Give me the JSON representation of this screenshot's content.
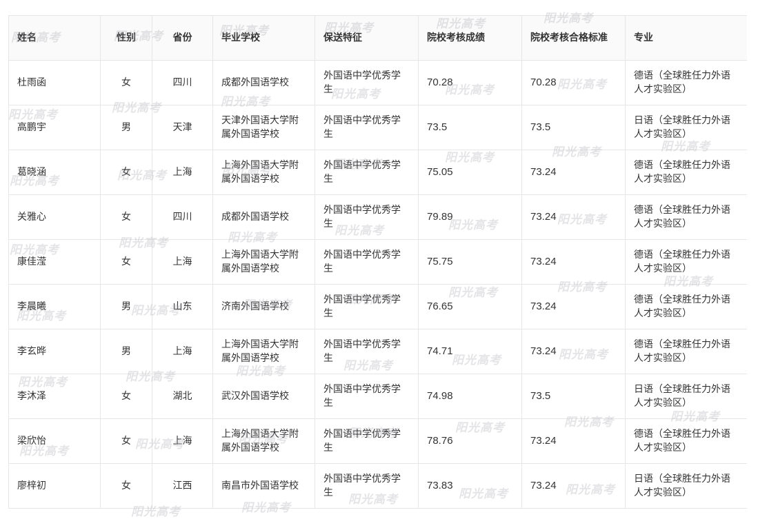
{
  "table": {
    "headers": {
      "name": "姓名",
      "gender": "性别",
      "province": "省份",
      "school": "毕业学校",
      "feature": "保送特征",
      "score": "院校考核成绩",
      "pass_line": "院校考核合格标准",
      "major": "专业"
    },
    "rows": [
      {
        "name": "杜雨函",
        "gender": "女",
        "province": "四川",
        "school": "成都外国语学校",
        "feature": "外国语中学优秀学生",
        "score": "70.28",
        "pass_line": "70.28",
        "major": "德语（全球胜任力外语人才实验区）"
      },
      {
        "name": "高鹏宇",
        "gender": "男",
        "province": "天津",
        "school": "天津外国语大学附属外国语学校",
        "feature": "外国语中学优秀学生",
        "score": "73.5",
        "pass_line": "73.5",
        "major": "日语（全球胜任力外语人才实验区）"
      },
      {
        "name": "葛晓涵",
        "gender": "女",
        "province": "上海",
        "school": "上海外国语大学附属外国语学校",
        "feature": "外国语中学优秀学生",
        "score": "75.05",
        "pass_line": "73.24",
        "major": "德语（全球胜任力外语人才实验区）"
      },
      {
        "name": "关雅心",
        "gender": "女",
        "province": "四川",
        "school": "成都外国语学校",
        "feature": "外国语中学优秀学生",
        "score": "79.89",
        "pass_line": "73.24",
        "major": "德语（全球胜任力外语人才实验区）"
      },
      {
        "name": "康佳滢",
        "gender": "女",
        "province": "上海",
        "school": "上海外国语大学附属外国语学校",
        "feature": "外国语中学优秀学生",
        "score": "75.75",
        "pass_line": "73.24",
        "major": "德语（全球胜任力外语人才实验区）"
      },
      {
        "name": "李晨曦",
        "gender": "男",
        "province": "山东",
        "school": "济南外国语学校",
        "feature": "外国语中学优秀学生",
        "score": "76.65",
        "pass_line": "73.24",
        "major": "德语（全球胜任力外语人才实验区）"
      },
      {
        "name": "李玄晔",
        "gender": "男",
        "province": "上海",
        "school": "上海外国语大学附属外国语学校",
        "feature": "外国语中学优秀学生",
        "score": "74.71",
        "pass_line": "73.24",
        "major": "德语（全球胜任力外语人才实验区）"
      },
      {
        "name": "李沐泽",
        "gender": "女",
        "province": "湖北",
        "school": "武汉外国语学校",
        "feature": "外国语中学优秀学生",
        "score": "74.98",
        "pass_line": "73.5",
        "major": "日语（全球胜任力外语人才实验区）"
      },
      {
        "name": "梁欣怡",
        "gender": "女",
        "province": "上海",
        "school": "上海外国语大学附属外国语学校",
        "feature": "外国语中学优秀学生",
        "score": "78.76",
        "pass_line": "73.24",
        "major": "德语（全球胜任力外语人才实验区）"
      },
      {
        "name": "廖梓初",
        "gender": "女",
        "province": "江西",
        "school": "南昌市外国语学校",
        "feature": "外国语中学优秀学生",
        "score": "73.83",
        "pass_line": "73.24",
        "major": "日语（全球胜任力外语人才实验区）"
      }
    ]
  },
  "watermark": {
    "text": "阳光高考",
    "color": "#aaaab4"
  }
}
